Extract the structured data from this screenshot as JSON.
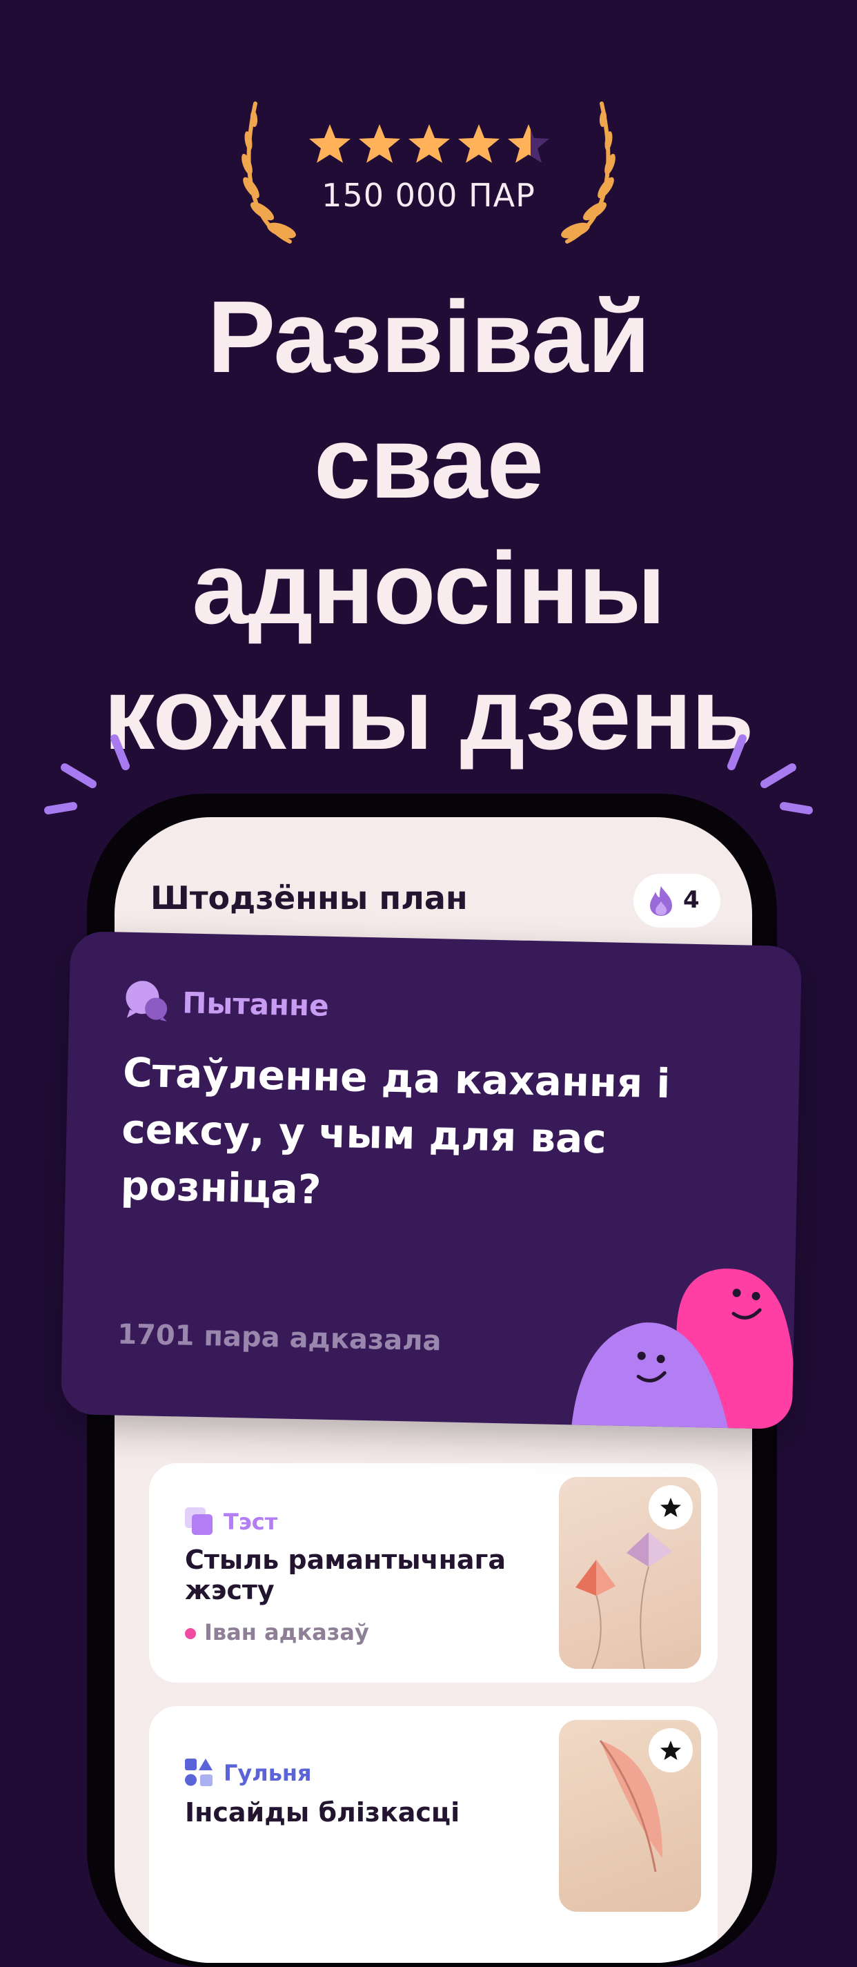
{
  "rating": {
    "stars_value": 4.7,
    "stars_max": 5,
    "pairs_count": "150 000 ПАР",
    "star_color": "#ffb25a",
    "laurel_color": "#f0a64c"
  },
  "headline": {
    "line1": "Развівай",
    "line2": "свае",
    "line3": "адносіны",
    "line4": "кожны дзень"
  },
  "app": {
    "plan_title": "Штодзённы план",
    "streak_count": "4",
    "streak_icon": "flame-icon"
  },
  "question_card": {
    "badge_label": "Пытанне",
    "badge_icon": "chat-bubbles-icon",
    "question": "Стаўленне да кахання і сексу, у чым для вас розніца?",
    "answered_text": "1701 пара адказала",
    "mascot_colors": [
      "#b37ef3",
      "#ff3fa4"
    ]
  },
  "tasks": [
    {
      "type_label": "Тэст",
      "type_color": "#b37ef3",
      "type_icon": "test-squares-icon",
      "title": "Стыль рамантычнага жэсту",
      "status_text": "Іван адказаў",
      "favorite_icon": "star-icon"
    },
    {
      "type_label": "Гульня",
      "type_color": "#5a63d8",
      "type_icon": "game-shapes-icon",
      "title": "Інсайды блізкасці",
      "favorite_icon": "star-icon"
    }
  ],
  "colors": {
    "background": "#200c35",
    "accent_purple": "#381a59",
    "spark_purple": "#a77aef"
  }
}
